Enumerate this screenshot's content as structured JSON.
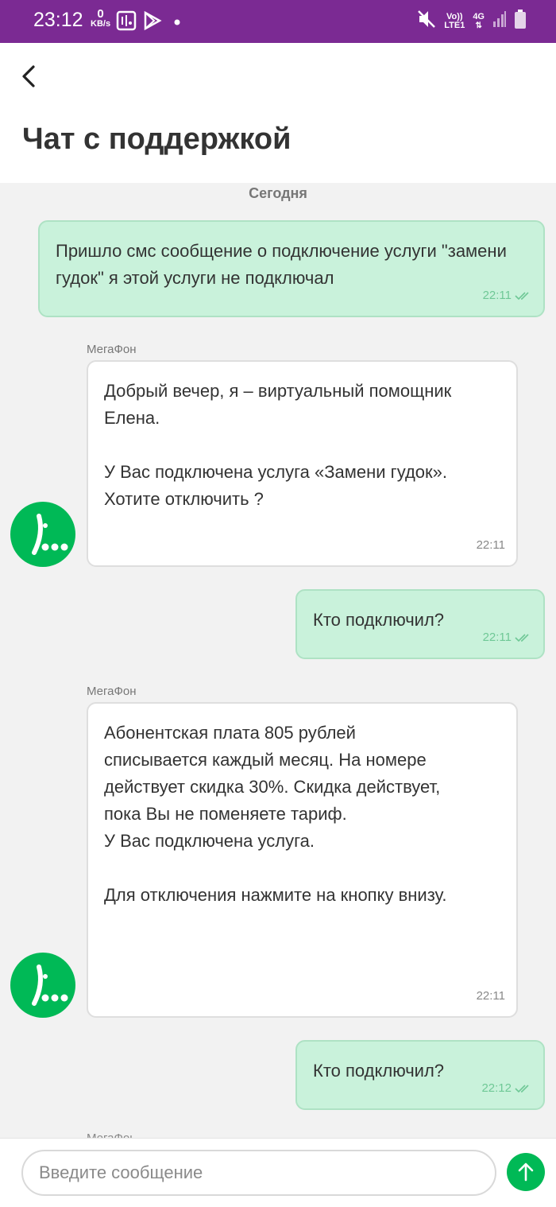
{
  "status_bar": {
    "time": "23:12",
    "speed_value": "0",
    "speed_unit": "KB/s",
    "volte": "Vo))",
    "lte": "LTE1",
    "network": "4G"
  },
  "header": {
    "title": "Чат с поддержкой"
  },
  "chat": {
    "date_separator": "Сегодня",
    "messages": [
      {
        "from": "user",
        "text": "Пришло смс сообщение о подключение услуги \"замени гудок\" я этой услуги не подключал",
        "time": "22:11"
      },
      {
        "from": "bot",
        "sender": "МегаФон",
        "text": "Добрый вечер, я – виртуальный помощник\nЕлена.\n\nУ Вас подключена услуга «Замени гудок».\nХотите отключить ?",
        "time": "22:11"
      },
      {
        "from": "user",
        "text": "Кто подключил?",
        "time": "22:11"
      },
      {
        "from": "bot",
        "sender": "МегаФон",
        "text": "Абонентская плата 805 рублей\nсписывается каждый месяц. На номере\nдействует скидка 30%. Скидка действует,\nпока Вы не поменяете тариф.\nУ Вас подключена услуга.\n\nДля отключения нажмите на кнопку внизу.",
        "time": "22:11"
      },
      {
        "from": "user",
        "text": "Кто подключил?",
        "time": "22:12"
      }
    ],
    "partial_sender": "МегаФон"
  },
  "composer": {
    "placeholder": "Введите сообщение"
  },
  "colors": {
    "status_bar": "#7b2a93",
    "brand_green": "#00b956",
    "user_bubble": "#c9f2db",
    "read_check": "#6fc896"
  }
}
